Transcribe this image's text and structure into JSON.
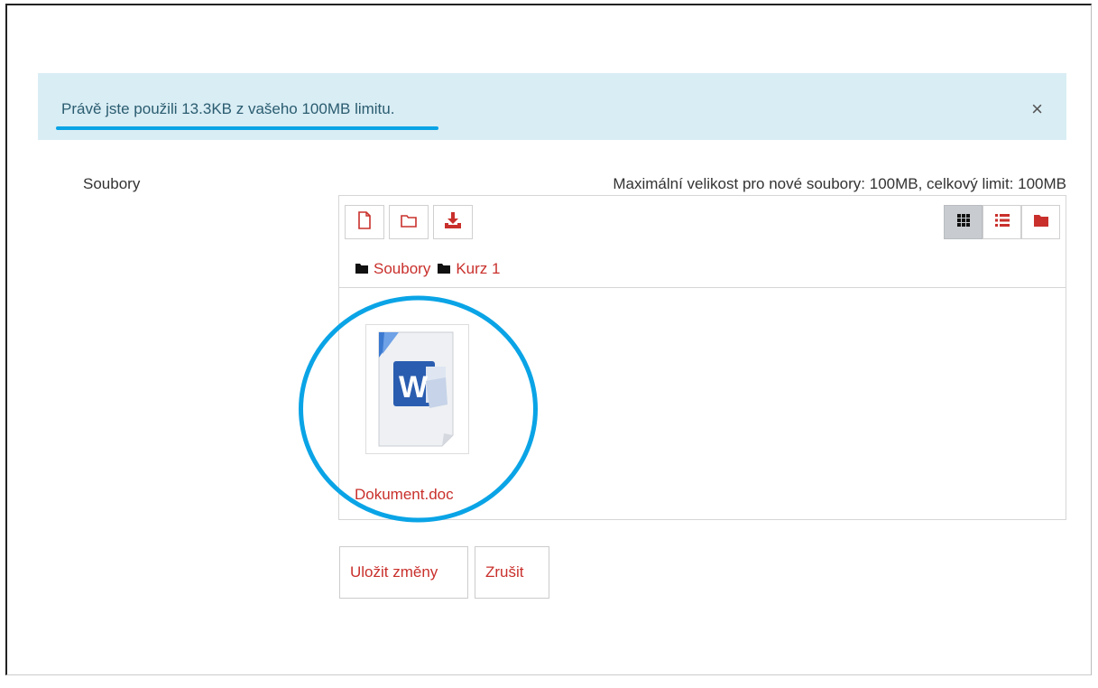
{
  "alert": {
    "message": "Právě jste použili 13.3KB z vašeho 100MB limitu.",
    "close_glyph": "×"
  },
  "form": {
    "files_label": "Soubory",
    "limits_text": "Maximální velikost pro nové soubory: 100MB, celkový limit: 100MB"
  },
  "filemanager": {
    "toolbar": {
      "add_file_icon": "file-icon",
      "create_folder_icon": "folder-icon",
      "download_icon": "download-icon"
    },
    "views": [
      {
        "icon": "grid-icon",
        "active": true
      },
      {
        "icon": "list-icon",
        "active": false
      },
      {
        "icon": "tree-folder-icon",
        "active": false
      }
    ],
    "breadcrumb": [
      "Soubory",
      "Kurz 1"
    ],
    "files": [
      {
        "name": "Dokument.doc",
        "icon": "word-document-icon"
      }
    ]
  },
  "buttons": {
    "save_label": "Uložit změny",
    "cancel_label": "Zrušit"
  },
  "colors": {
    "alert_bg": "#d9edf4",
    "accent_red": "#c9302c",
    "annotation_blue": "#0aa4e6"
  }
}
